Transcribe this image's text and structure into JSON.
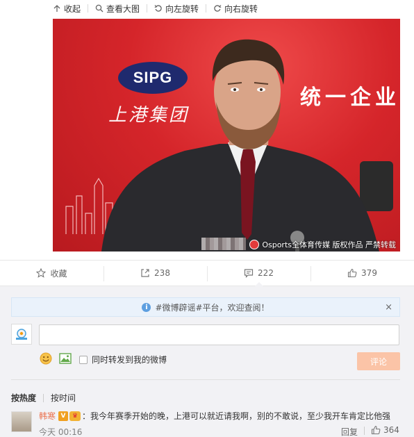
{
  "toolbar": {
    "collapse_label": "收起",
    "view_large_label": "查看大图",
    "rotate_left_label": "向左旋转",
    "rotate_right_label": "向右旋转"
  },
  "photo": {
    "sign_logo": "SIPG",
    "sign_chinese": "上港集团",
    "banner_text": "统一企业",
    "watermark": "Osports全体育传媒  版权作品 严禁转载"
  },
  "actions": {
    "favorite_label": "收藏",
    "repost_count": "238",
    "comment_count": "222",
    "like_count": "379"
  },
  "notice": {
    "text": "#微博辟谣#平台，欢迎查阅！",
    "close": "×"
  },
  "composer": {
    "input_value": "",
    "repost_label": "同时转发到我的微博",
    "submit_label": "评论"
  },
  "sort": {
    "by_hot": "按热度",
    "by_time": "按时间"
  },
  "comments": [
    {
      "name": "韩寒",
      "text": "：我今年赛季开始的晚，上港可以就近请我啊，别的不敢说，至少我开车肯定比他强",
      "time": "今天 00:16",
      "reply_label": "回复",
      "likes": "364"
    }
  ],
  "colors": {
    "accent_orange": "#eb7350",
    "submit_disabled": "#fbc4a7",
    "panel_bg": "#f2f2f5",
    "notice_bg": "#eaf2fb"
  }
}
